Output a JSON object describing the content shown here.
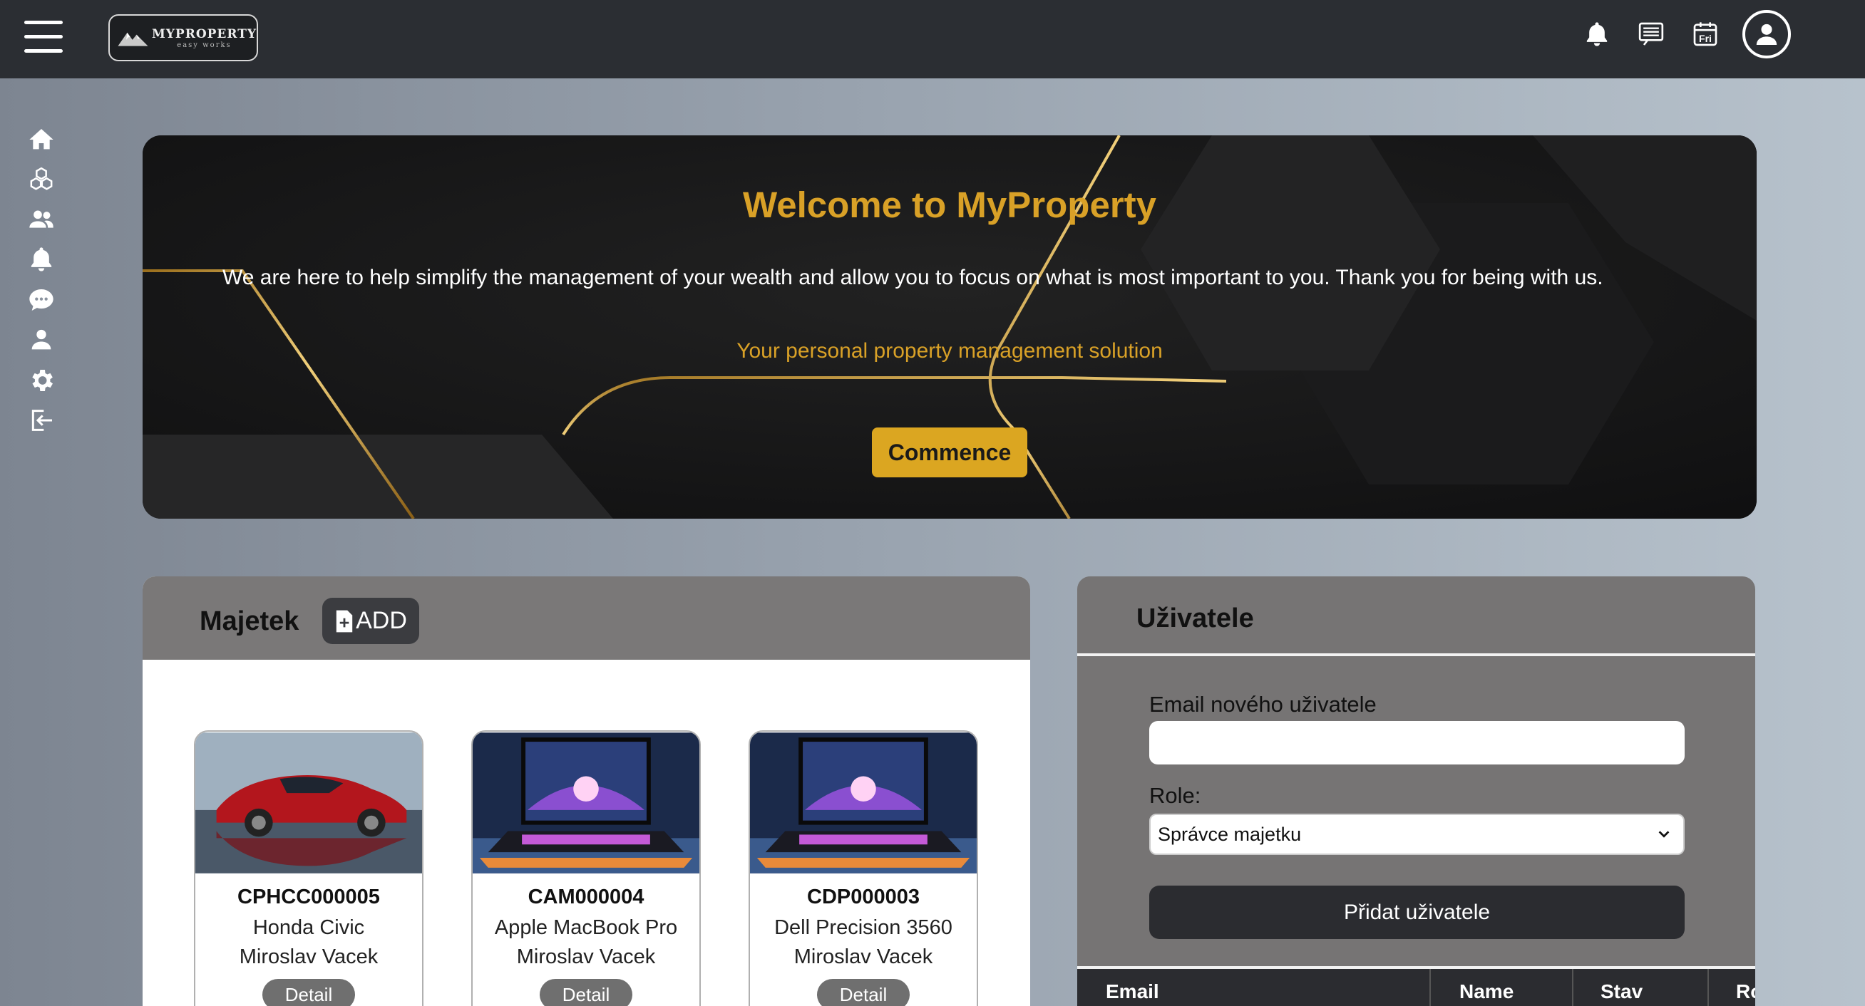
{
  "brand": {
    "name": "MYPROPERTY",
    "tagline": "easy works"
  },
  "topbar": {
    "icons": [
      "bell-icon",
      "messages-icon",
      "calendar-icon",
      "user-circle-icon"
    ],
    "calendar_day": "Fri"
  },
  "sidebar": {
    "items": [
      {
        "icon": "home-icon"
      },
      {
        "icon": "boxes-icon"
      },
      {
        "icon": "users-icon"
      },
      {
        "icon": "bell-icon"
      },
      {
        "icon": "chat-icon"
      },
      {
        "icon": "user-icon"
      },
      {
        "icon": "gear-icon"
      },
      {
        "icon": "logout-icon"
      }
    ]
  },
  "hero": {
    "title": "Welcome to MyProperty",
    "text": "We are here to help simplify the management of your wealth and allow you to focus on what is most important to you. Thank you for being with us.",
    "subtitle": "Your personal property management solution",
    "button": "Commence"
  },
  "assets": {
    "title": "Majetek",
    "add_label": "ADD",
    "cards": [
      {
        "code": "CPHCC000005",
        "name": "Honda Civic",
        "owner": "Miroslav Vacek",
        "detail": "Detail",
        "image": "red-sports-car"
      },
      {
        "code": "CAM000004",
        "name": "Apple MacBook Pro",
        "owner": "Miroslav Vacek",
        "detail": "Detail",
        "image": "laptop"
      },
      {
        "code": "CDP000003",
        "name": "Dell Precision 3560",
        "owner": "Miroslav Vacek",
        "detail": "Detail",
        "image": "laptop"
      }
    ]
  },
  "users": {
    "title": "Uživatele",
    "email_label": "Email nového uživatele",
    "email_value": "",
    "role_label": "Role:",
    "role_selected": "Správce majetku",
    "add_button": "Přidat uživatele",
    "table_headers": [
      "Email",
      "Name",
      "Stav",
      "Ro"
    ]
  },
  "colors": {
    "accent_gold": "#d9a127",
    "topbar": "#2b2e33",
    "panel_header": "#7a7878"
  }
}
